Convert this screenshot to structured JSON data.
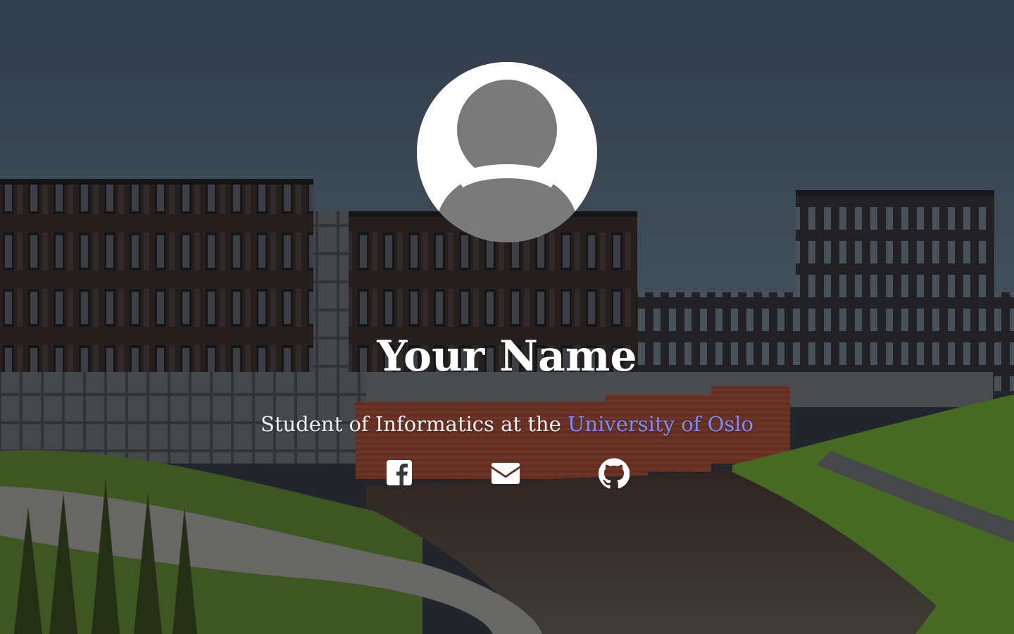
{
  "profile": {
    "name": "Your Name",
    "tagline_prefix": "Student of Informatics at the ",
    "university_link": "University of Oslo"
  },
  "social": [
    {
      "icon": "facebook-square-icon"
    },
    {
      "icon": "envelope-icon"
    },
    {
      "icon": "github-icon"
    }
  ],
  "colors": {
    "text": "#ffffff",
    "link": "#7d8cff",
    "avatar_bg": "#ffffff",
    "avatar_silhouette": "#7a7a7a"
  }
}
